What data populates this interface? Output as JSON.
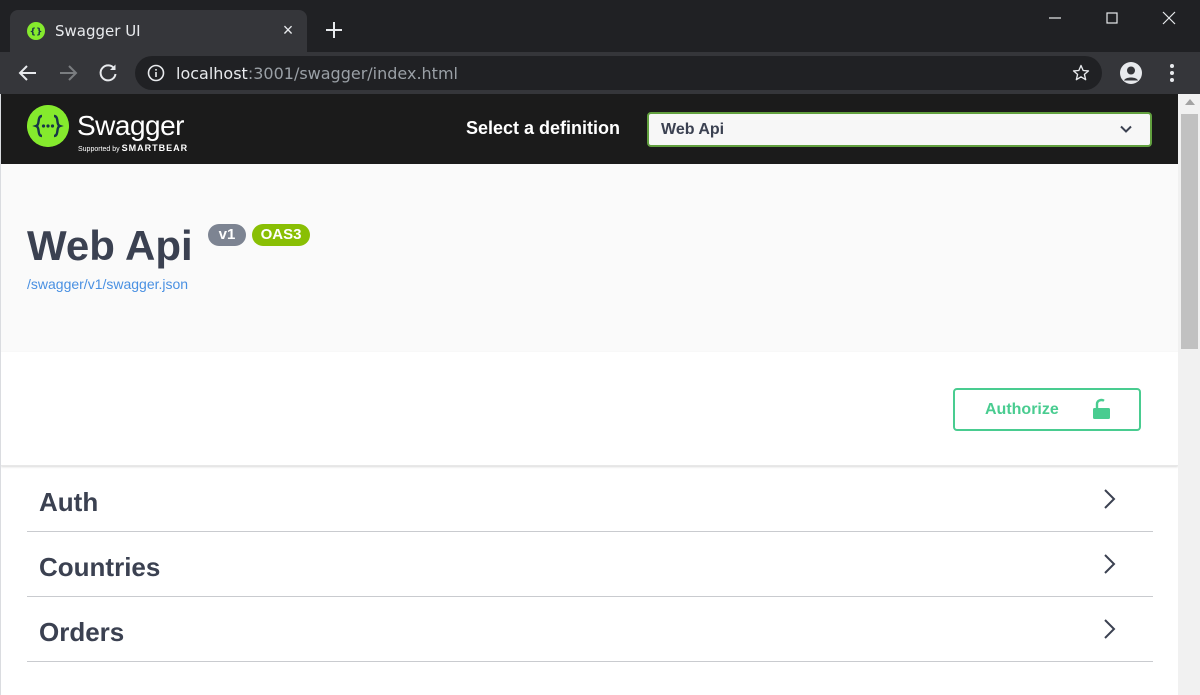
{
  "browser": {
    "tab_title": "Swagger UI",
    "tab_close": "×",
    "url_host": "localhost",
    "url_rest": ":3001/swagger/index.html"
  },
  "topbar": {
    "logo_text": "Swagger",
    "logo_sub_prefix": "Supported by",
    "logo_sub_brand": "SMARTBEAR",
    "definition_label": "Select a definition",
    "definition_value": "Web Api"
  },
  "info": {
    "title": "Web Api",
    "version_badge": "v1",
    "oas_badge": "OAS3",
    "spec_link": "/swagger/v1/swagger.json"
  },
  "authorize": {
    "label": "Authorize"
  },
  "tags": [
    {
      "name": "Auth"
    },
    {
      "name": "Countries"
    },
    {
      "name": "Orders"
    }
  ],
  "colors": {
    "topbar_bg": "#1b1b1b",
    "brand_green": "#85ea2d",
    "select_border": "#62a03f",
    "authorize_green": "#49cc90",
    "text_dark": "#3b4151",
    "link_blue": "#4990e2",
    "badge_version": "#7d8492",
    "badge_oas": "#89bf04"
  }
}
